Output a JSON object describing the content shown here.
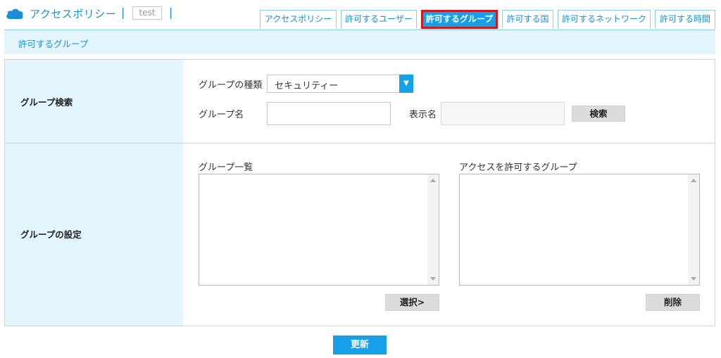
{
  "header": {
    "app_title": "アクセスポリシー",
    "separator": "|",
    "tenant": "test",
    "icon": "cloud-icon"
  },
  "tabs": [
    {
      "label": "アクセスポリシー",
      "active": false
    },
    {
      "label": "許可するユーザー",
      "active": false
    },
    {
      "label": "許可するグループ",
      "active": true
    },
    {
      "label": "許可する国",
      "active": false
    },
    {
      "label": "許可するネットワーク",
      "active": false
    },
    {
      "label": "許可する時間",
      "active": false
    }
  ],
  "subbar": {
    "title": "許可するグループ"
  },
  "search": {
    "section_label": "グループ検索",
    "type_label": "グループの種類",
    "type_value": "セキュリティー",
    "name_label": "グループ名",
    "name_value": "",
    "display_label": "表示名",
    "display_value": "",
    "search_button": "検索"
  },
  "settings": {
    "section_label": "グループの設定",
    "list_label": "グループ一覧",
    "allowed_label": "アクセスを許可するグループ",
    "select_button": "選択>",
    "delete_button": "削除"
  },
  "footer": {
    "update_button": "更新"
  },
  "colors": {
    "accent": "#16a0ea",
    "active_border": "#d11a1a",
    "label_bg": "#e3f5fd"
  }
}
